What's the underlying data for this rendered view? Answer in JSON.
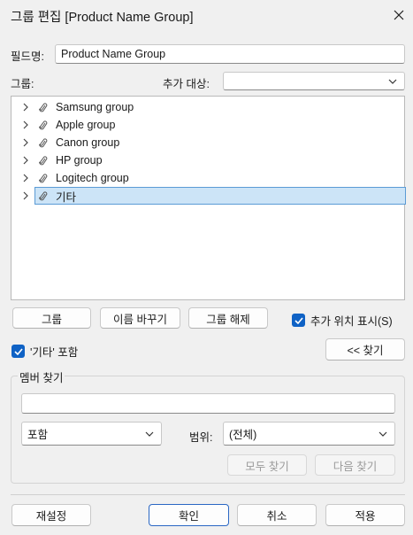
{
  "dialog": {
    "title": "그룹 편집 [Product Name Group]"
  },
  "field_name": {
    "label": "필드명:",
    "value": "Product Name Group"
  },
  "group_label": "그룹:",
  "add_target": {
    "label": "추가 대상:",
    "value": ""
  },
  "tree": {
    "items": [
      {
        "label": "Samsung group"
      },
      {
        "label": "Apple group"
      },
      {
        "label": "Canon group"
      },
      {
        "label": "HP group"
      },
      {
        "label": "Logitech group"
      },
      {
        "label": "기타",
        "selected": true
      }
    ]
  },
  "buttons": {
    "group": "그룹",
    "rename": "이름 바꾸기",
    "ungroup": "그룹 해제",
    "find_back": "<< 찾기",
    "find_all": "모두 찾기",
    "find_next": "다음 찾기",
    "reset": "재설정",
    "ok": "확인",
    "cancel": "취소",
    "apply": "적용"
  },
  "checkboxes": {
    "show_add_location": {
      "label": "추가 위치 표시(S)",
      "checked": true
    },
    "include_other": {
      "label": "'기타' 포함",
      "checked": true
    }
  },
  "member_find": {
    "legend": "멤버 찾기",
    "search_value": "",
    "match_mode": "포함",
    "range_label": "범위:",
    "range_value": "(전체)"
  },
  "colors": {
    "accent": "#0f62c5",
    "selection": "#cce4f7"
  }
}
